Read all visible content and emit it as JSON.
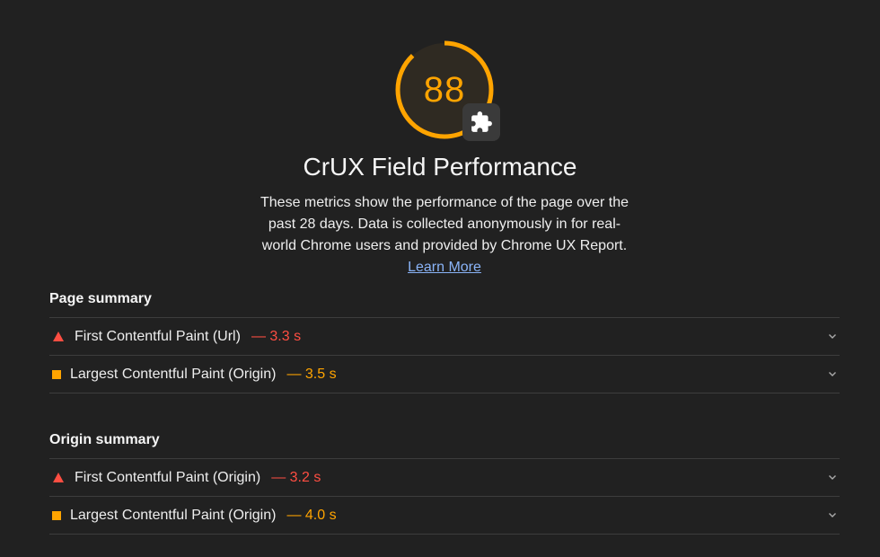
{
  "score": {
    "value": 88,
    "fraction": 0.88,
    "color": "#ffa400",
    "badge_icon": "puzzle-piece-icon"
  },
  "title": "CrUX Field Performance",
  "description": {
    "text": "These metrics show the performance of the page over the past 28 days. Data is collected anonymously in for real-world Chrome users and provided by Chrome UX Report.",
    "link_label": "Learn More"
  },
  "page_summary": {
    "heading": "Page summary",
    "metrics": [
      {
        "label": "First Contentful Paint (Url)",
        "value": "— 3.3 s",
        "status": "fail",
        "icon": "triangle-icon"
      },
      {
        "label": "Largest Contentful Paint (Origin)",
        "value": "— 3.5 s",
        "status": "average",
        "icon": "square-icon"
      }
    ]
  },
  "origin_summary": {
    "heading": "Origin summary",
    "metrics": [
      {
        "label": "First Contentful Paint (Origin)",
        "value": "— 3.2 s",
        "status": "fail",
        "icon": "triangle-icon"
      },
      {
        "label": "Largest Contentful Paint (Origin)",
        "value": "— 4.0 s",
        "status": "average",
        "icon": "square-icon"
      }
    ]
  },
  "colors": {
    "background": "#212121",
    "fail": "#ff4e42",
    "average": "#ffa400",
    "link": "#8ab4f8"
  }
}
